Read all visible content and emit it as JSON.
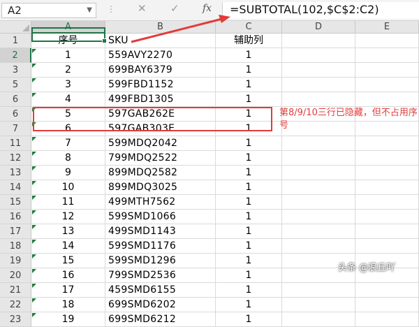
{
  "formula_bar": {
    "name_box": "A2",
    "formula": "=SUBTOTAL(102,$C$2:C2)",
    "icons": {
      "cancel": "close-icon",
      "enter": "check-icon",
      "fx": "function-icon"
    },
    "fx_label": "fx",
    "dots": "⋮"
  },
  "columns": [
    {
      "letter": "A",
      "selected": true
    },
    {
      "letter": "B",
      "selected": false
    },
    {
      "letter": "C",
      "selected": false
    },
    {
      "letter": "D",
      "selected": false
    },
    {
      "letter": "E",
      "selected": false
    }
  ],
  "header_row": {
    "row": "1",
    "a": "序号",
    "b": "SKU",
    "c": "辅助列"
  },
  "rows": [
    {
      "row": "2",
      "a": "1",
      "b": "559AVY2270",
      "c": "1"
    },
    {
      "row": "3",
      "a": "2",
      "b": "699BAY6379",
      "c": "1"
    },
    {
      "row": "5",
      "a": "3",
      "b": "599FBD1152",
      "c": "1"
    },
    {
      "row": "6",
      "a": "4",
      "b": "499FBD1305",
      "c": "1"
    },
    {
      "row": "6",
      "a": "5",
      "b": "597GAB262E",
      "c": "1"
    },
    {
      "row": "7",
      "a": "6",
      "b": "597GAB303E",
      "c": "1"
    },
    {
      "row": "11",
      "a": "7",
      "b": "599MDQ2042",
      "c": "1"
    },
    {
      "row": "12",
      "a": "8",
      "b": "799MDQ2522",
      "c": "1"
    },
    {
      "row": "13",
      "a": "9",
      "b": "899MDQ2582",
      "c": "1"
    },
    {
      "row": "14",
      "a": "10",
      "b": "899MDQ3025",
      "c": "1"
    },
    {
      "row": "15",
      "a": "11",
      "b": "499MTH7562",
      "c": "1"
    },
    {
      "row": "16",
      "a": "12",
      "b": "599SMD1066",
      "c": "1"
    },
    {
      "row": "17",
      "a": "13",
      "b": "499SMD1143",
      "c": "1"
    },
    {
      "row": "18",
      "a": "14",
      "b": "599SMD1176",
      "c": "1"
    },
    {
      "row": "19",
      "a": "15",
      "b": "599SMD1296",
      "c": "1"
    },
    {
      "row": "20",
      "a": "16",
      "b": "799SMD2536",
      "c": "1"
    },
    {
      "row": "21",
      "a": "17",
      "b": "459SMD6155",
      "c": "1"
    },
    {
      "row": "22",
      "a": "18",
      "b": "699SMD6202",
      "c": "1"
    },
    {
      "row": "23",
      "a": "19",
      "b": "699SMD6212",
      "c": "1"
    }
  ],
  "annotation": {
    "note": "第8/9/10三行已隐藏，但不占用序号",
    "color": "#e23b3b"
  },
  "watermark": "头条 @浪丘吖",
  "colors": {
    "accent": "#217346",
    "annotation": "#e23b3b"
  }
}
